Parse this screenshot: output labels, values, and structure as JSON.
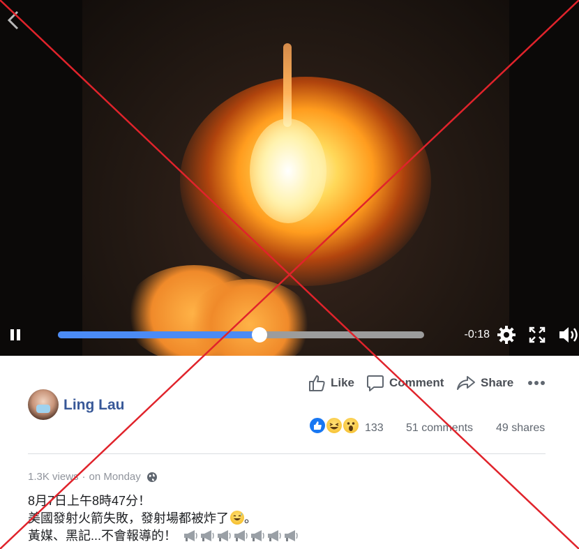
{
  "video": {
    "time_remaining": "-0:18",
    "progress": 0.55,
    "icons": [
      "back-chevron-icon",
      "pause-icon",
      "settings-gear-icon",
      "fullscreen-icon",
      "volume-icon"
    ]
  },
  "post": {
    "author": "Ling Lau",
    "actions": {
      "like": "Like",
      "comment": "Comment",
      "share": "Share"
    },
    "reactions_count": "133",
    "comments_count": "51 comments",
    "shares_count": "49 shares",
    "views": "1.3K views",
    "separator": "·",
    "posted": "on Monday",
    "text_lines": [
      "8月7日上午8時47分！",
      "美國發射火箭失敗，發射場都被炸了",
      "。",
      "黃媒、黑記...不會報導的！"
    ],
    "emoji_icons": [
      "grinning-sweat-emoji-icon",
      "megaphone-icon"
    ]
  },
  "colors": {
    "progress_fill": "#4b8bf5",
    "progress_track": "#9c9c9c",
    "author_link": "#385898",
    "overlay_x": "#e0232b"
  }
}
